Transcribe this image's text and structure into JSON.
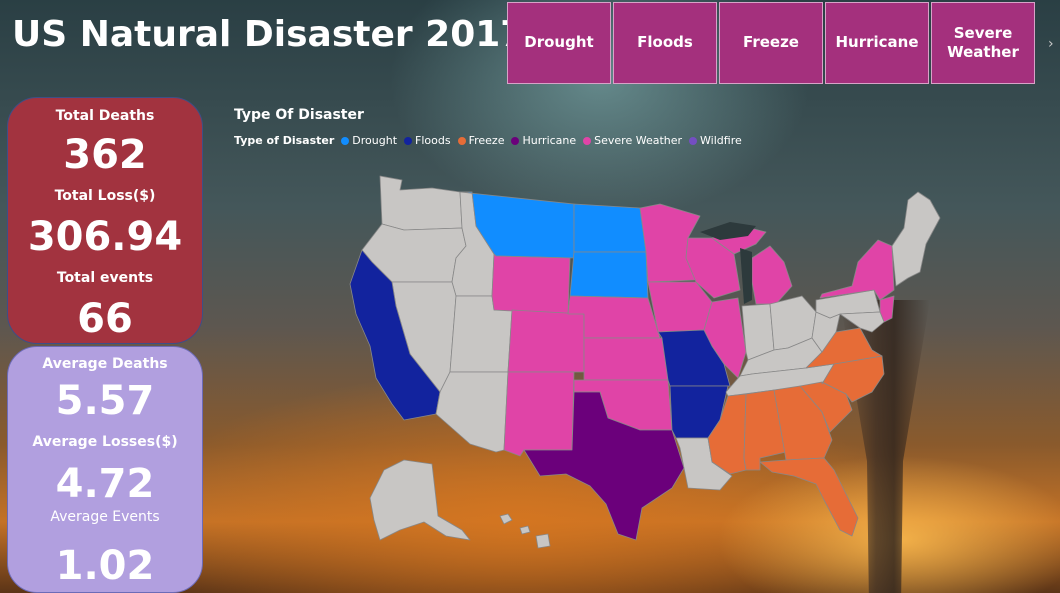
{
  "title": "US Natural Disaster 2017",
  "slicer": {
    "items": [
      "Drought",
      "Floods",
      "Freeze",
      "Hurricane",
      "Severe Weather"
    ],
    "more_icon": "chevron-right-icon"
  },
  "kpis_primary": {
    "total_deaths_label": "Total Deaths",
    "total_deaths_value": "362",
    "total_loss_label": "Total Loss($)",
    "total_loss_value": "306.94",
    "total_events_label": "Total events",
    "total_events_value": "66"
  },
  "kpis_average": {
    "avg_deaths_label": "Average Deaths",
    "avg_deaths_value": "5.57",
    "avg_losses_label": "Average Losses($)",
    "avg_losses_value": "4.72",
    "avg_events_label": "Average Events",
    "avg_events_value": "1.02"
  },
  "map": {
    "title": "Type Of Disaster",
    "legend_title": "Type of Disaster",
    "legend": [
      {
        "name": "Drought",
        "color": "#118dff"
      },
      {
        "name": "Floods",
        "color": "#12239e"
      },
      {
        "name": "Freeze",
        "color": "#e66c37"
      },
      {
        "name": "Hurricane",
        "color": "#6b007b"
      },
      {
        "name": "Severe Weather",
        "color": "#e044a7"
      },
      {
        "name": "Wildfire",
        "color": "#744ec2"
      }
    ],
    "no_data_color": "#c8c6c4"
  }
}
